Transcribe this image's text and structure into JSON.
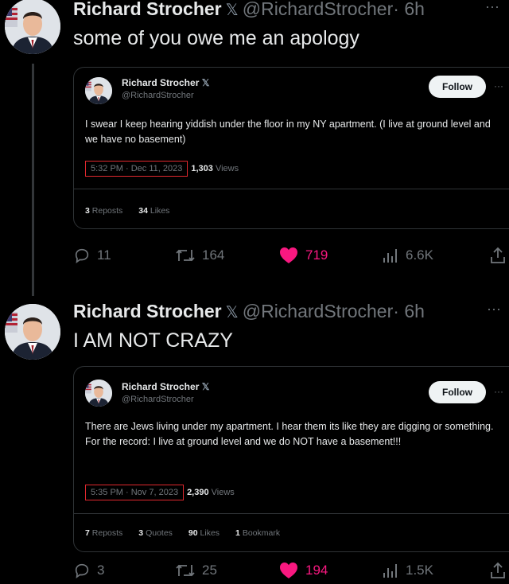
{
  "posts": [
    {
      "author": "Richard Strocher",
      "handle": "@RichardStrocher",
      "time": "· 6h",
      "text": "some of you owe me an apology",
      "quote": {
        "author": "Richard Strocher",
        "handle": "@RichardStrocher",
        "follow_label": "Follow",
        "body": "I swear I keep hearing yiddish under the floor in my NY apartment. (I live at ground level and we have no basement)",
        "timestamp": "5:32 PM · Dec 11, 2023",
        "views_count": "1,303",
        "views_label": "Views",
        "stats": [
          {
            "count": "3",
            "label": "Reposts"
          },
          {
            "count": "34",
            "label": "Likes"
          }
        ]
      },
      "actions": {
        "replies": "11",
        "reposts": "164",
        "likes": "719",
        "views": "6.6K"
      }
    },
    {
      "author": "Richard Strocher",
      "handle": "@RichardStrocher",
      "time": "· 6h",
      "text": "I AM NOT CRAZY",
      "quote": {
        "author": "Richard Strocher",
        "handle": "@RichardStrocher",
        "follow_label": "Follow",
        "body": "There are Jews living under my apartment. I hear them its like they are digging or something. For the record: I live at ground level and we do NOT have a basement!!!",
        "timestamp": "5:35 PM · Nov 7, 2023",
        "views_count": "2,390",
        "views_label": "Views",
        "stats": [
          {
            "count": "7",
            "label": "Reposts"
          },
          {
            "count": "3",
            "label": "Quotes"
          },
          {
            "count": "90",
            "label": "Likes"
          },
          {
            "count": "1",
            "label": "Bookmark"
          }
        ]
      },
      "actions": {
        "replies": "3",
        "reposts": "25",
        "likes": "194",
        "views": "1.5K"
      }
    }
  ],
  "colors": {
    "background": "#000000",
    "like_pink": "#f91880",
    "highlight_box": "#e0282e",
    "muted": "#71767b"
  },
  "icons": [
    "avatar",
    "x-logo-icon",
    "more-icon",
    "reply-icon",
    "repost-icon",
    "like-icon",
    "views-icon",
    "share-icon"
  ]
}
